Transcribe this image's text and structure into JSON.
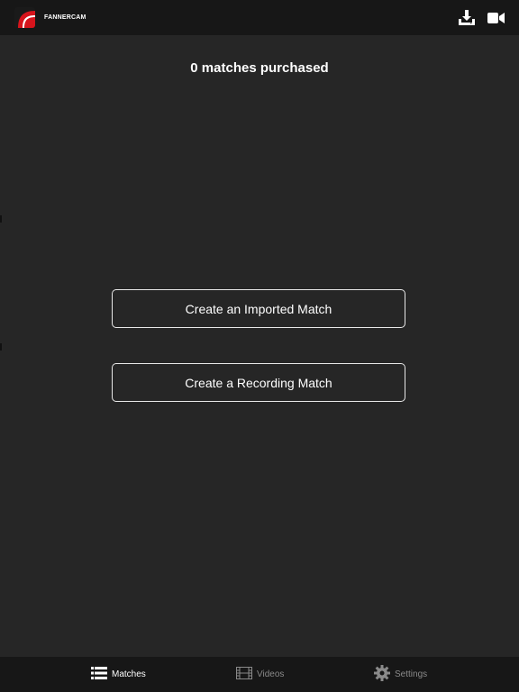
{
  "app": {
    "name": "FANNERCAM",
    "brand_color": "#d6141c",
    "background": "#262626",
    "bar_background": "#171717"
  },
  "header": {
    "actions": [
      {
        "icon": "download-icon"
      },
      {
        "icon": "video-camera-icon"
      }
    ]
  },
  "main": {
    "title": "0 matches purchased",
    "buttons": [
      {
        "label": "Create an Imported Match"
      },
      {
        "label": "Create a Recording Match"
      }
    ]
  },
  "tabs": [
    {
      "label": "Matches",
      "icon": "list-icon",
      "active": true
    },
    {
      "label": "Videos",
      "icon": "film-icon",
      "active": false
    },
    {
      "label": "Settings",
      "icon": "gear-icon",
      "active": false
    }
  ]
}
